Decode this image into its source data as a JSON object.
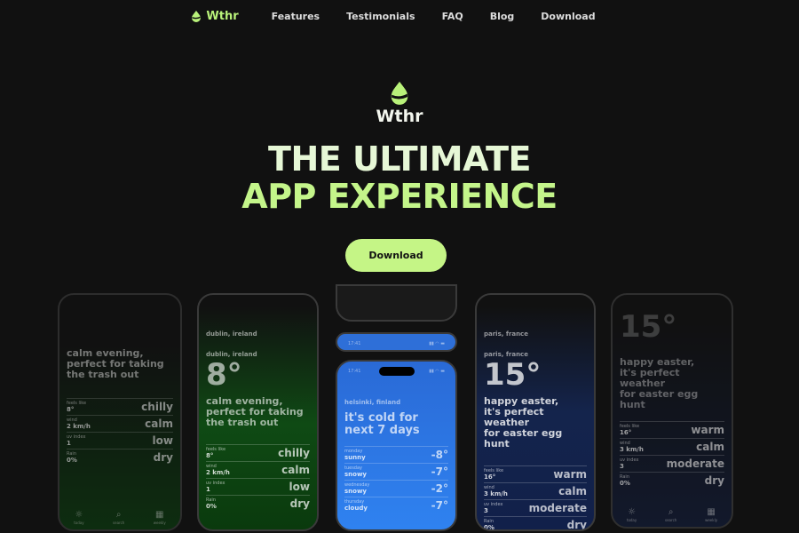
{
  "nav": {
    "brand": "Wthr",
    "items": [
      "Features",
      "Testimonials",
      "FAQ",
      "Blog",
      "Download"
    ]
  },
  "hero": {
    "brand": "Wthr",
    "line1": "THE ULTIMATE",
    "line2": "APP EXPERIENCE",
    "cta": "Download"
  },
  "colors": {
    "accent": "#c5f586",
    "background": "#111111",
    "green_phone": "#0f4a14",
    "blue_phone": "#2f7ae6",
    "navy_phone": "#15254d"
  },
  "phones": {
    "dublin": {
      "location": "dublin, ireland",
      "temp": "8°",
      "message": [
        "calm evening,",
        "perfect for taking",
        "the trash out"
      ],
      "rows": [
        {
          "k": "feels like",
          "v": "8°",
          "r": "chilly"
        },
        {
          "k": "wind",
          "v": "2 km/h",
          "r": "calm"
        },
        {
          "k": "uv index",
          "v": "1",
          "r": "low"
        },
        {
          "k": "Rain",
          "v": "0%",
          "r": "dry"
        }
      ]
    },
    "paris": {
      "location": "paris, france",
      "temp": "15°",
      "message": [
        "happy easter,",
        "it's perfect weather",
        "for  easter egg hunt"
      ],
      "rows": [
        {
          "k": "feels like",
          "v": "16°",
          "r": "warm"
        },
        {
          "k": "wind",
          "v": "3 km/h",
          "r": "calm"
        },
        {
          "k": "uv index",
          "v": "3",
          "r": "moderate"
        },
        {
          "k": "Rain",
          "v": "0%",
          "r": "dry"
        }
      ]
    },
    "helsinki": {
      "time": "17:41",
      "location": "helsinki, finland",
      "message": [
        "it's cold for",
        "next 7 days"
      ],
      "days": [
        {
          "k": "monday",
          "v": "sunny",
          "r": "-8°"
        },
        {
          "k": "tuesday",
          "v": "snowy",
          "r": "-7°"
        },
        {
          "k": "wednesday",
          "v": "snowy",
          "r": "-2°"
        },
        {
          "k": "thursday",
          "v": "cloudy",
          "r": "-7°"
        }
      ]
    },
    "tabs": [
      "today",
      "search",
      "weekly"
    ]
  }
}
